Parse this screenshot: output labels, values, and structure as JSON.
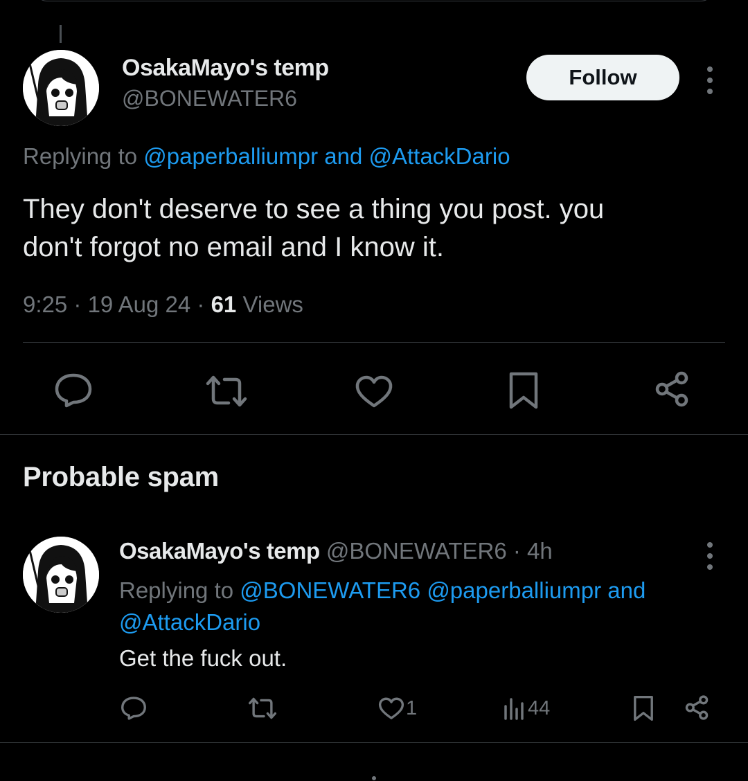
{
  "theme": {
    "background": "#000000",
    "text_primary": "#e7e9ea",
    "text_secondary": "#71767b",
    "link": "#1d9bf0",
    "divider": "#2f3336",
    "follow_button_bg": "#eff3f4"
  },
  "main_tweet": {
    "display_name": "OsakaMayo's temp",
    "handle": "@BONEWATER6",
    "follow_label": "Follow",
    "replying_prefix": "Replying to",
    "replying_user_1": "@paperballiumpr",
    "replying_and": "and",
    "replying_user_2": "@AttackDario",
    "text_line_1": "They don't deserve to see a thing you post. you",
    "text_line_2": "don't forgot no email and I know it.",
    "time": "9:25",
    "date": "19 Aug 24",
    "separator": "·",
    "views_count": "61",
    "views_label": "Views",
    "actions": [
      "reply-icon",
      "retweet-icon",
      "like-icon",
      "bookmark-icon",
      "share-icon"
    ]
  },
  "section": {
    "title": "Probable spam"
  },
  "reply_tweet": {
    "display_name": "OsakaMayo's temp",
    "handle": "@BONEWATER6",
    "separator": "·",
    "age": "4h",
    "replying_prefix": "Replying to",
    "replying_user_1": "@BONEWATER6",
    "replying_user_2": "@paperballiumpr",
    "replying_and": "and",
    "replying_user_3": "@AttackDario",
    "text": "Get the fuck out.",
    "like_count": "1",
    "views_count": "44",
    "actions": [
      "reply-icon",
      "retweet-icon",
      "like-icon",
      "views-icon",
      "bookmark-icon",
      "share-icon"
    ]
  }
}
